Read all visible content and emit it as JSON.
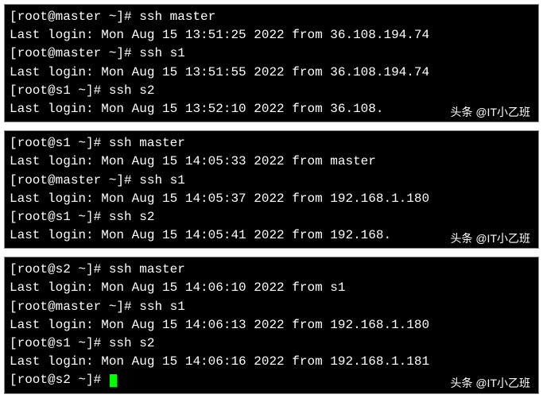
{
  "blocks": [
    {
      "lines": [
        {
          "prompt": "[root@master ~]# ",
          "command": "ssh master",
          "login": null
        },
        {
          "prompt": null,
          "command": null,
          "login": "Last login: Mon Aug 15 13:51:25 2022 from 36.108.194.74"
        },
        {
          "prompt": "[root@master ~]# ",
          "command": "ssh s1",
          "login": null
        },
        {
          "prompt": null,
          "command": null,
          "login": "Last login: Mon Aug 15 13:51:55 2022 from 36.108.194.74"
        },
        {
          "prompt": "[root@s1 ~]# ",
          "command": "ssh s2",
          "login": null
        },
        {
          "prompt": null,
          "command": null,
          "login": "Last login: Mon Aug 15 13:52:10 2022 from 36.108."
        }
      ],
      "watermark": "头条 @IT小乙班",
      "has_trailing_prompt": false,
      "trailing_prompt": ""
    },
    {
      "lines": [
        {
          "prompt": "[root@s1 ~]# ",
          "command": "ssh master",
          "login": null
        },
        {
          "prompt": null,
          "command": null,
          "login": "Last login: Mon Aug 15 14:05:33 2022 from master"
        },
        {
          "prompt": "[root@master ~]# ",
          "command": "ssh s1",
          "login": null
        },
        {
          "prompt": null,
          "command": null,
          "login": "Last login: Mon Aug 15 14:05:37 2022 from 192.168.1.180"
        },
        {
          "prompt": "[root@s1 ~]# ",
          "command": "ssh s2",
          "login": null
        },
        {
          "prompt": null,
          "command": null,
          "login": "Last login: Mon Aug 15 14:05:41 2022 from 192.168."
        }
      ],
      "watermark": "头条 @IT小乙班",
      "has_trailing_prompt": false,
      "trailing_prompt": ""
    },
    {
      "lines": [
        {
          "prompt": "[root@s2 ~]# ",
          "command": "ssh master",
          "login": null
        },
        {
          "prompt": null,
          "command": null,
          "login": "Last login: Mon Aug 15 14:06:10 2022 from s1"
        },
        {
          "prompt": "[root@master ~]# ",
          "command": "ssh s1",
          "login": null
        },
        {
          "prompt": null,
          "command": null,
          "login": "Last login: Mon Aug 15 14:06:13 2022 from 192.168.1.180"
        },
        {
          "prompt": "[root@s1 ~]# ",
          "command": "ssh s2",
          "login": null
        },
        {
          "prompt": null,
          "command": null,
          "login": "Last login: Mon Aug 15 14:06:16 2022 from 192.168.1.181"
        },
        {
          "prompt": "[root@s2 ~]# ",
          "command": "",
          "login": null,
          "cursor": true
        }
      ],
      "watermark": "头条 @IT小乙班",
      "has_trailing_prompt": false,
      "trailing_prompt": ""
    }
  ]
}
